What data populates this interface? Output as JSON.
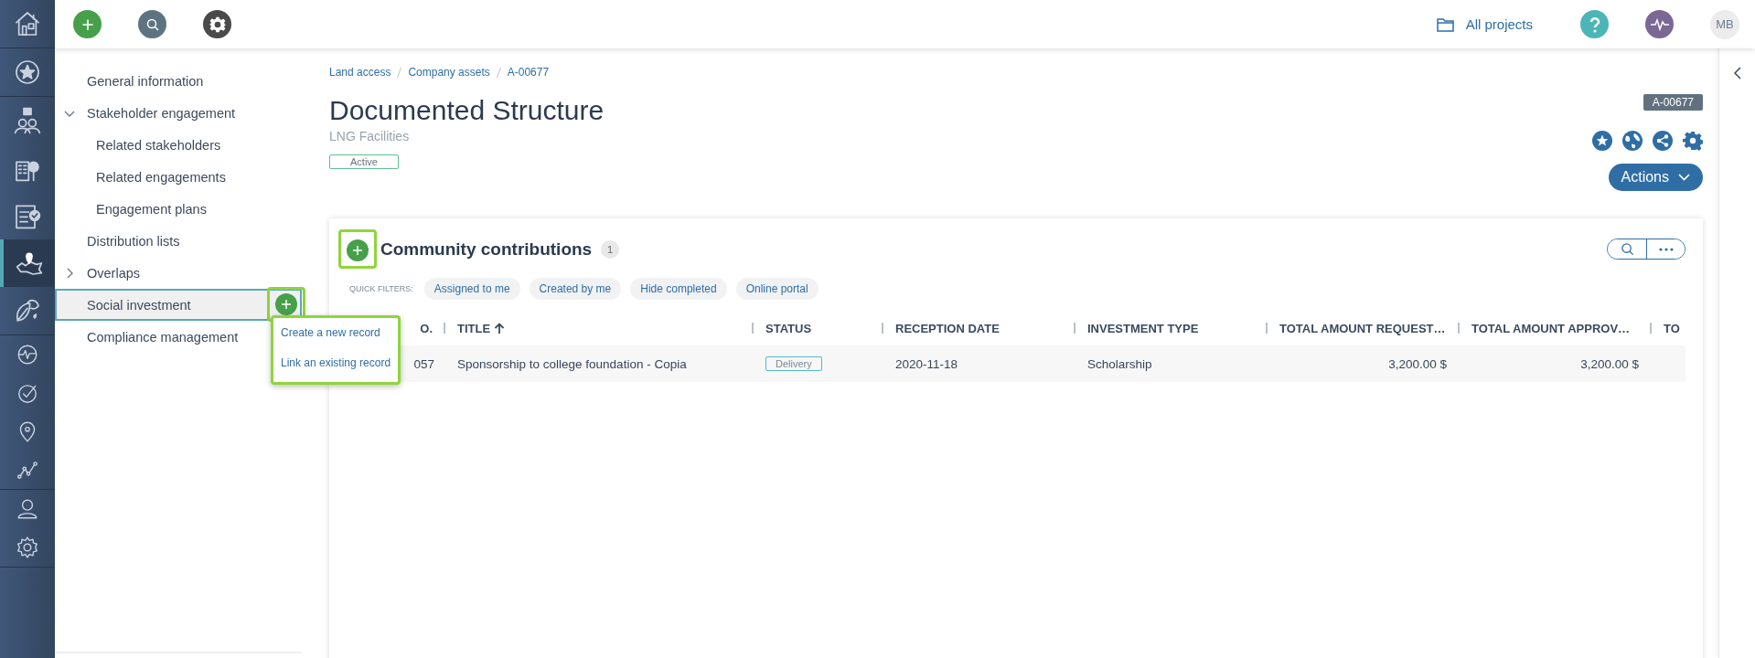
{
  "rail_items": [
    {
      "selected": false
    },
    {
      "selected": false
    },
    {
      "selected": false
    },
    {
      "selected": false
    },
    {
      "selected": false
    },
    {
      "selected": true
    },
    {
      "selected": false
    },
    {
      "selected": false
    },
    {
      "selected": false
    },
    {
      "selected": false
    },
    {
      "selected": false
    },
    {
      "selected": false
    },
    {
      "selected": false
    }
  ],
  "top_bar": {
    "projects_link": "All projects",
    "avatar": "MB"
  },
  "nav": [
    {
      "label": "General information",
      "selected": false
    },
    {
      "label": "Stakeholder engagement",
      "selected": false,
      "expanded": true,
      "children": [
        {
          "label": "Related stakeholders",
          "selected": false
        },
        {
          "label": "Related engagements",
          "selected": false
        },
        {
          "label": "Engagement plans",
          "selected": false
        }
      ]
    },
    {
      "label": "Distribution lists",
      "selected": false
    },
    {
      "label": "Overlaps",
      "selected": false,
      "expanded": false
    },
    {
      "label": "Social investment",
      "selected": true
    },
    {
      "label": "Compliance management",
      "selected": false
    }
  ],
  "add_menu": [
    "Create a new record",
    "Link an existing record"
  ],
  "breadcrumb": [
    "Land access",
    "Company assets",
    "A-00677"
  ],
  "title": "Documented Structure",
  "subtitle": "LNG Facilities",
  "status": "Active",
  "record_id": "A-00677",
  "actions_button": "Actions",
  "card": {
    "title": "Community contributions",
    "count": "1",
    "quick_filters_label": "QUICK FILTERS:",
    "quick_filters": [
      "Assigned to me",
      "Created by me",
      "Hide completed",
      "Online portal"
    ],
    "columns": [
      {
        "label": "O.",
        "sorted": false
      },
      {
        "label": "TITLE",
        "sorted": true
      },
      {
        "label": "STATUS",
        "sorted": false
      },
      {
        "label": "RECEPTION DATE",
        "sorted": false
      },
      {
        "label": "INVESTMENT TYPE",
        "sorted": false
      },
      {
        "label": "TOTAL AMOUNT REQUEST…",
        "sorted": false
      },
      {
        "label": "TOTAL AMOUNT APPROV…",
        "sorted": false
      },
      {
        "label": "TO",
        "sorted": false
      }
    ],
    "rows": [
      {
        "ref": "057",
        "title": "Sponsorship to college foundation - Copia",
        "status": "Delivery",
        "reception_date": "2020-11-18",
        "investment_type": "Scholarship",
        "requested": "3,200.00 $",
        "approved": "3,200.00 $"
      }
    ]
  }
}
